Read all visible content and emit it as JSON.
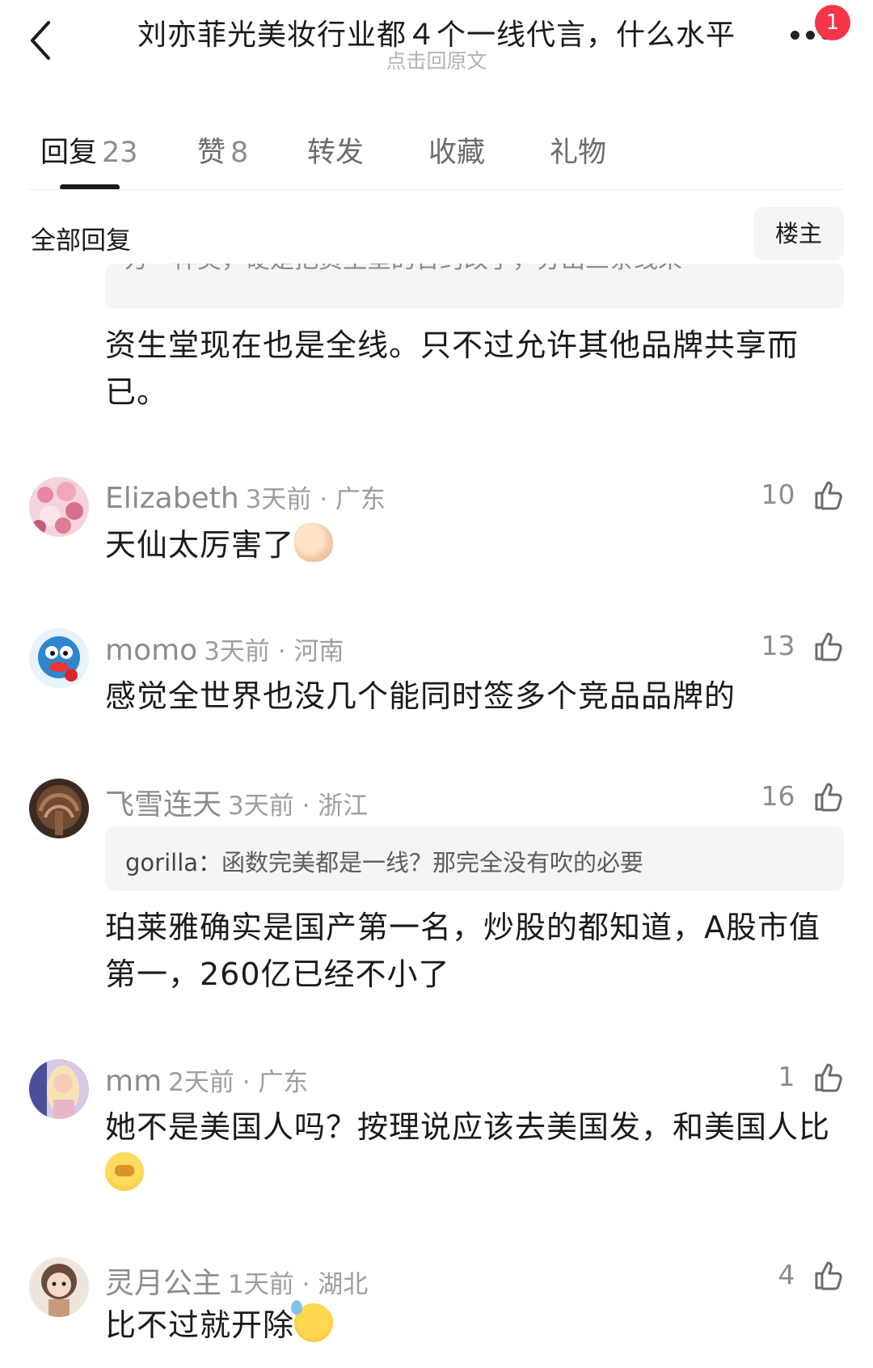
{
  "header": {
    "title": "刘亦菲光美妆行业都４个一线代言，什么水平",
    "subtitle": "点击回原文",
    "notification_count": "1",
    "back_icon": "chevron-left-icon",
    "more_icon": "more-dots-icon"
  },
  "tabs": [
    {
      "label": "回复",
      "count": "23",
      "active": true
    },
    {
      "label": "赞",
      "count": "8"
    },
    {
      "label": "转发",
      "count": ""
    },
    {
      "label": "收藏",
      "count": ""
    },
    {
      "label": "礼物",
      "count": ""
    }
  ],
  "section": {
    "title": "全部回复",
    "owner_button": "楼主"
  },
  "top_partial": {
    "quote_text": "方一样美，硬是把资生堂的合约改了，分出三条线来",
    "text": "资生堂现在也是全线。只不过允许其他品牌共享而已。"
  },
  "comments": [
    {
      "name": "Elizabeth",
      "meta": "3天前 · 广东",
      "likes": "10",
      "text": "天仙太厉害了",
      "emoji": "thumbs-up-emoji"
    },
    {
      "name": "momo",
      "meta": "3天前 · 河南",
      "likes": "13",
      "text": "感觉全世界也没几个能同时签多个竞品品牌的"
    },
    {
      "name": "飞雪连天",
      "meta": "3天前 · 浙江",
      "likes": "16",
      "quote_name": "gorilla：",
      "quote_text": "函数完美都是一线？那完全没有吹的必要",
      "text": "珀莱雅确实是国产第一名，炒股的都知道，A股市值第一，260亿已经不小了"
    },
    {
      "name": "mm",
      "meta": "2天前 · 广东",
      "likes": "1",
      "text": "她不是美国人吗？按理说应该去美国发，和美国人比",
      "emoji": "face-with-hand-over-mouth-emoji"
    },
    {
      "name": "灵月公主",
      "meta": "1天前 · 湖北",
      "likes": "4",
      "text": "比不过就开除",
      "emoji": "downcast-face-with-sweat-emoji"
    }
  ],
  "colors": {
    "badge": "#f5364a",
    "text_primary": "#1a1a1a",
    "text_secondary": "#8c8c8c",
    "quote_bg": "#f5f5f5"
  },
  "like_icon": "thumbs-up-outline-icon"
}
